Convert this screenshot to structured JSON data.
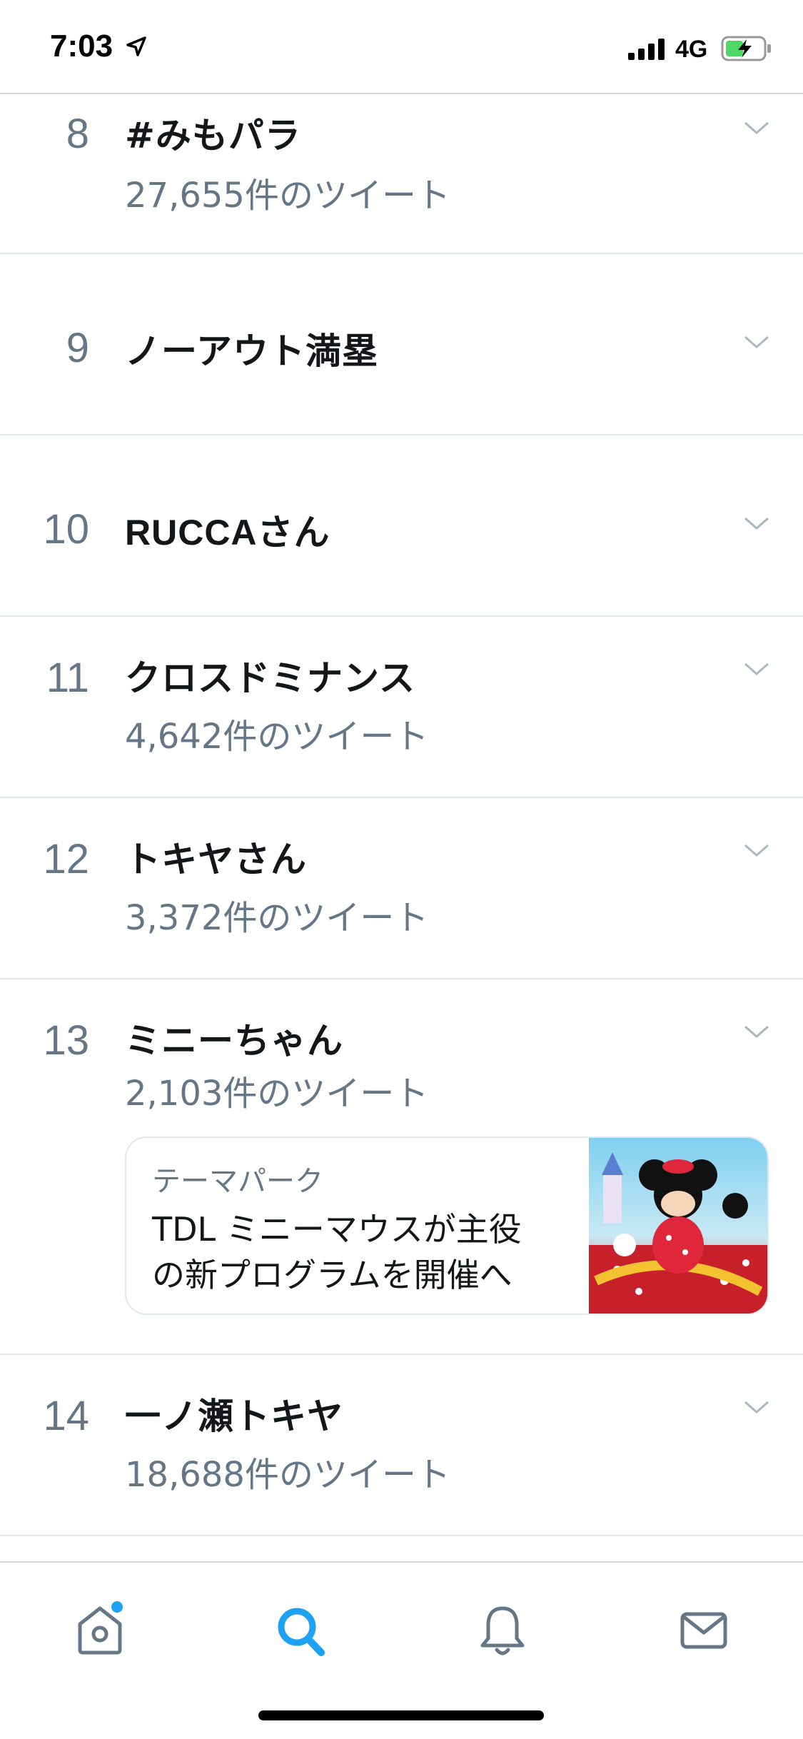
{
  "status_bar": {
    "time": "7:03",
    "network": "4G",
    "icons": [
      "location-arrow-icon",
      "signal-icon",
      "battery-charging-icon"
    ]
  },
  "trends": [
    {
      "rank": "8",
      "name": "#みもパラ",
      "count": "27,655件のツイート"
    },
    {
      "rank": "9",
      "name": "ノーアウト満塁",
      "count": ""
    },
    {
      "rank": "10",
      "name": "RUCCAさん",
      "count": ""
    },
    {
      "rank": "11",
      "name": "クロスドミナンス",
      "count": "4,642件のツイート"
    },
    {
      "rank": "12",
      "name": "トキヤさん",
      "count": "3,372件のツイート"
    },
    {
      "rank": "13",
      "name": "ミニーちゃん",
      "count": "2,103件のツイート",
      "news": {
        "category": "テーマパーク",
        "title": "TDL ミニーマウスが主役\nの新プログラムを開催へ"
      }
    },
    {
      "rank": "14",
      "name": "一ノ瀬トキヤ",
      "count": "18,688件のツイート"
    }
  ],
  "tab_bar": {
    "tabs": [
      {
        "icon": "home-icon",
        "active": false,
        "has_badge": true
      },
      {
        "icon": "search-icon",
        "active": true,
        "has_badge": false
      },
      {
        "icon": "notifications-bell-icon",
        "active": false,
        "has_badge": false
      },
      {
        "icon": "messages-envelope-icon",
        "active": false,
        "has_badge": false
      }
    ]
  },
  "colors": {
    "accent": "#1da1f2",
    "text_primary": "#14171a",
    "text_secondary": "#657786",
    "divider": "#e1e8ed"
  }
}
